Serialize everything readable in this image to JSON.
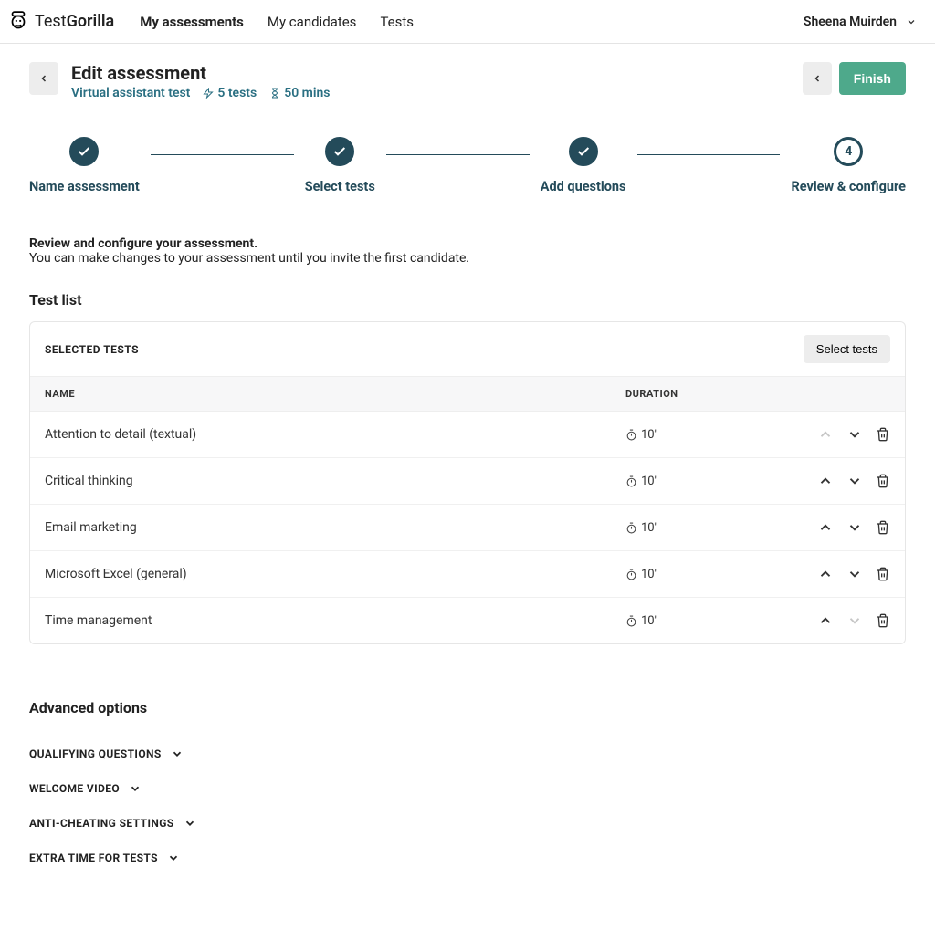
{
  "brand": {
    "name_thin": "Test",
    "name_bold": "Gorilla"
  },
  "nav": {
    "items": [
      {
        "label": "My assessments",
        "active": true
      },
      {
        "label": "My candidates",
        "active": false
      },
      {
        "label": "Tests",
        "active": false
      }
    ],
    "user": "Sheena Muirden"
  },
  "header": {
    "title": "Edit assessment",
    "assessment_name": "Virtual assistant test",
    "tests_count": "5 tests",
    "duration": "50 mins",
    "finish_label": "Finish"
  },
  "stepper": [
    {
      "label": "Name assessment",
      "state": "done"
    },
    {
      "label": "Select tests",
      "state": "done"
    },
    {
      "label": "Add questions",
      "state": "done"
    },
    {
      "label": "Review & configure",
      "state": "active",
      "number": "4"
    }
  ],
  "intro": {
    "heading": "Review and configure your assessment.",
    "sub": "You can make changes to your assessment until you invite the first candidate."
  },
  "testlist": {
    "section_title": "Test list",
    "card_title": "SELECTED TESTS",
    "select_btn": "Select tests",
    "col_name": "NAME",
    "col_duration": "DURATION",
    "rows": [
      {
        "name": "Attention to detail (textual)",
        "duration": "10'",
        "up_disabled": true,
        "down_disabled": false
      },
      {
        "name": "Critical thinking",
        "duration": "10'",
        "up_disabled": false,
        "down_disabled": false
      },
      {
        "name": "Email marketing",
        "duration": "10'",
        "up_disabled": false,
        "down_disabled": false
      },
      {
        "name": "Microsoft Excel (general)",
        "duration": "10'",
        "up_disabled": false,
        "down_disabled": false
      },
      {
        "name": "Time management",
        "duration": "10'",
        "up_disabled": false,
        "down_disabled": true
      }
    ]
  },
  "advanced": {
    "title": "Advanced options",
    "items": [
      "QUALIFYING QUESTIONS",
      "WELCOME VIDEO",
      "ANTI-CHEATING SETTINGS",
      "EXTRA TIME FOR TESTS"
    ]
  }
}
